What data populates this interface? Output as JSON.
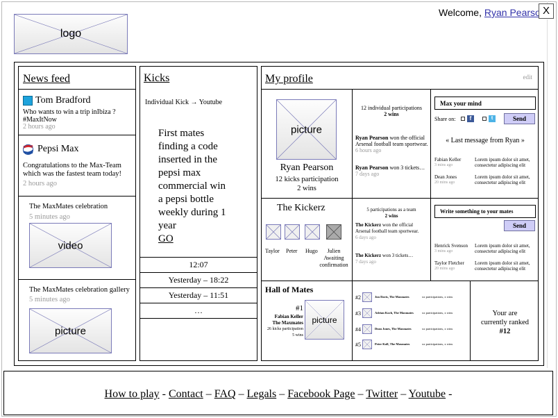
{
  "header": {
    "logo_label": "logo",
    "welcome_text": "Welcome,",
    "user_name": "Ryan Pearson",
    "close_label": "X"
  },
  "news_feed": {
    "title": "News feed",
    "items": [
      {
        "author": "Tom Bradford",
        "text": "Who wants to win a trip inIbiza ? #MaxItNow",
        "time": "2 hours ago"
      },
      {
        "author": "Pepsi Max",
        "text": "Congratulations to the Max-Team which was the fastest team today!",
        "time": "2 hours ago"
      },
      {
        "title": "The MaxMates celebration",
        "time": "5 minutes ago",
        "media": "video"
      },
      {
        "title": "The MaxMates celebration gallery",
        "time": "5 minutes ago",
        "media": "picture"
      }
    ]
  },
  "kicks": {
    "title": "Kicks",
    "subtitle_left": "Individual Kick",
    "subtitle_arrow": "→",
    "subtitle_right": "Youtube",
    "lines": [
      "First mates",
      "finding a code",
      "inserted in the",
      "pepsi max",
      "commercial win",
      "a pepsi bottle",
      "weekly during 1",
      "year"
    ],
    "go_label": "GO",
    "times": [
      "12:07",
      "Yesterday – 18:22",
      "Yesterday – 11:51",
      "…"
    ]
  },
  "profile": {
    "title": "My profile",
    "edit_label": "edit",
    "picture_label": "picture",
    "name": "Ryan Pearson",
    "participations": "12 kicks participation",
    "wins": "2 wins",
    "stats_line1": "12 individual participations",
    "stats_line2": "2 wins",
    "activity": [
      {
        "name": "Ryan Pearson",
        "text": "won the official Arsenal football team sportwear.",
        "time": "6 hours ago"
      },
      {
        "name": "Ryan Pearson",
        "text": "won 3 tickets…",
        "time": "7 days ago"
      }
    ],
    "mind_placeholder": "Max your mind",
    "share_label": "Share on:",
    "send_label": "Send",
    "last_message": "« Last message from Ryan »",
    "messages": [
      {
        "name": "Fabian Keller",
        "time": "3 mins ago",
        "text": "Lorem ipsum dolor sit amet, consectetur adipiscing elit"
      },
      {
        "name": "Dean Jones",
        "time": "20 mins ago",
        "text": "Lorem ipsum dolor sit amet, consectetur adipiscing elit"
      }
    ]
  },
  "team": {
    "name": "The Kickerz",
    "members": [
      {
        "name": "Taylor",
        "pending": false
      },
      {
        "name": "Peter",
        "pending": false
      },
      {
        "name": "Hugo",
        "pending": false
      },
      {
        "name": "Julien",
        "pending": true,
        "status": "Awaiting confirmation"
      }
    ],
    "stats_line1": "5 participations as a team",
    "stats_line2": "2 wins",
    "activity": [
      {
        "name": "The Kickerz",
        "text": "won the official Arsenal football team sportwear.",
        "time": "6 days ago"
      },
      {
        "name": "The Kickerz",
        "text": "won 3 tickets…",
        "time": "7 days ago"
      }
    ],
    "mates_placeholder": "Write something to your mates",
    "send_label": "Send",
    "messages": [
      {
        "name": "Henrick Svenson",
        "time": "3 mins ago",
        "text": "Lorem ipsum dolor sit amet, consectetur adipiscing elit"
      },
      {
        "name": "Taylor Fletcher",
        "time": "20 mins ago",
        "text": "Lorem ipsum dolor sit amet, consectetur adipiscing elit"
      }
    ]
  },
  "hall": {
    "title": "Hall of Mates",
    "top_rank": "#1",
    "top_name": "Fabian Keller",
    "top_team": "The Maxmates",
    "top_participations": "26 kicks participation",
    "top_wins": "5 wins",
    "picture_label": "picture",
    "others": [
      {
        "rank": "#2",
        "name": "Jon Davis, The Maxmates",
        "stats": "xx participations, x wins"
      },
      {
        "rank": "#3",
        "name": "Adrian Koch, The Maxmates",
        "stats": "xx participations, x wins"
      },
      {
        "rank": "#4",
        "name": "Dean Jones, The Maxmates",
        "stats": "xx participations, x wins"
      },
      {
        "rank": "#5",
        "name": "Peter Koll, The Maxmates",
        "stats": "xx participations, x wins"
      }
    ],
    "rank_line1": "Your are",
    "rank_line2": "currently ranked",
    "rank_value": "#12"
  },
  "footer": {
    "links": [
      "How to play",
      "Contact",
      "FAQ",
      "Legals",
      "Facebook Page",
      "Twitter",
      "Youtube"
    ],
    "separators": [
      " - ",
      " – ",
      " – ",
      " – ",
      " – ",
      " – ",
      " -"
    ]
  },
  "colors": {
    "pepsi_red": "#d6262b",
    "pepsi_blue": "#1f4fa3",
    "tom_avatar": "#1ea3dc",
    "send_bg": "#cfcdf7",
    "placeholder_border": "#7a7ab8"
  }
}
